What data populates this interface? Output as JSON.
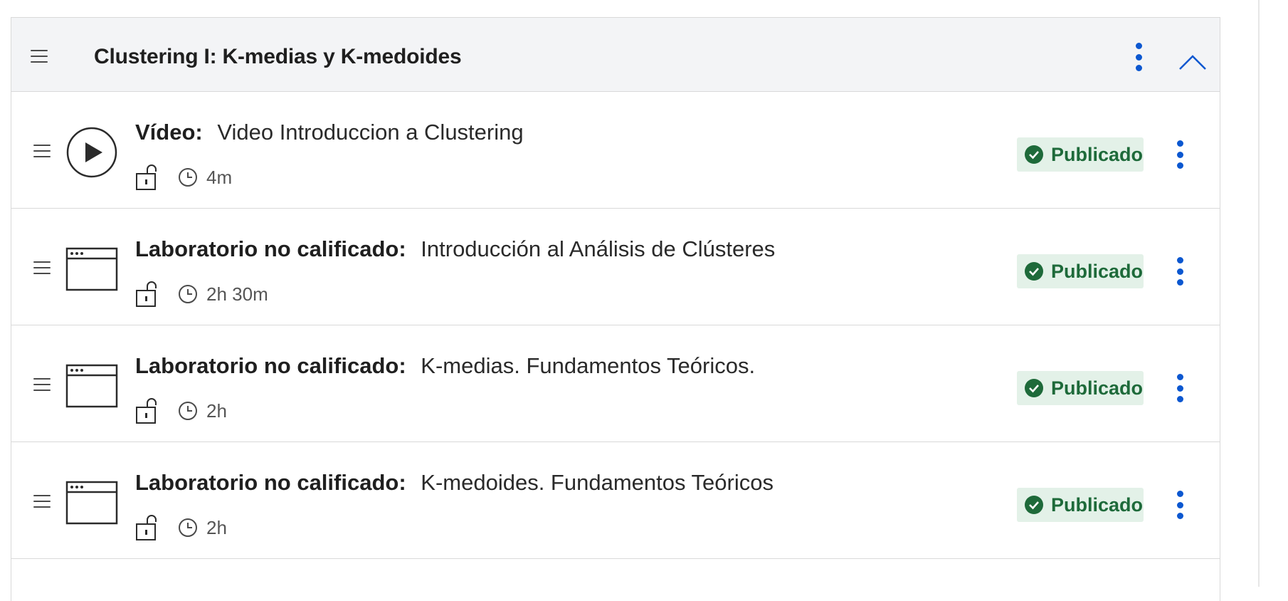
{
  "module": {
    "title": "Clustering I: K-medias y K-medoides"
  },
  "colors": {
    "accent": "#0b57d0",
    "published_bg": "#e3f1e8",
    "published_text": "#1e6a3a",
    "header_bg": "#f3f4f6"
  },
  "items": [
    {
      "icon": "play-circle-icon",
      "type": "Vídeo:",
      "title": "Video Introduccion a Clustering",
      "duration": "4m",
      "status": "Publicado"
    },
    {
      "icon": "browser-window-icon",
      "type": "Laboratorio no calificado:",
      "title": "Introducción al Análisis de Clústeres",
      "duration": "2h 30m",
      "status": "Publicado"
    },
    {
      "icon": "browser-window-icon",
      "type": "Laboratorio no calificado:",
      "title": "K-medias. Fundamentos Teóricos.",
      "duration": "2h",
      "status": "Publicado"
    },
    {
      "icon": "browser-window-icon",
      "type": "Laboratorio no calificado:",
      "title": "K-medoides. Fundamentos Teóricos",
      "duration": "2h",
      "status": "Publicado"
    }
  ]
}
